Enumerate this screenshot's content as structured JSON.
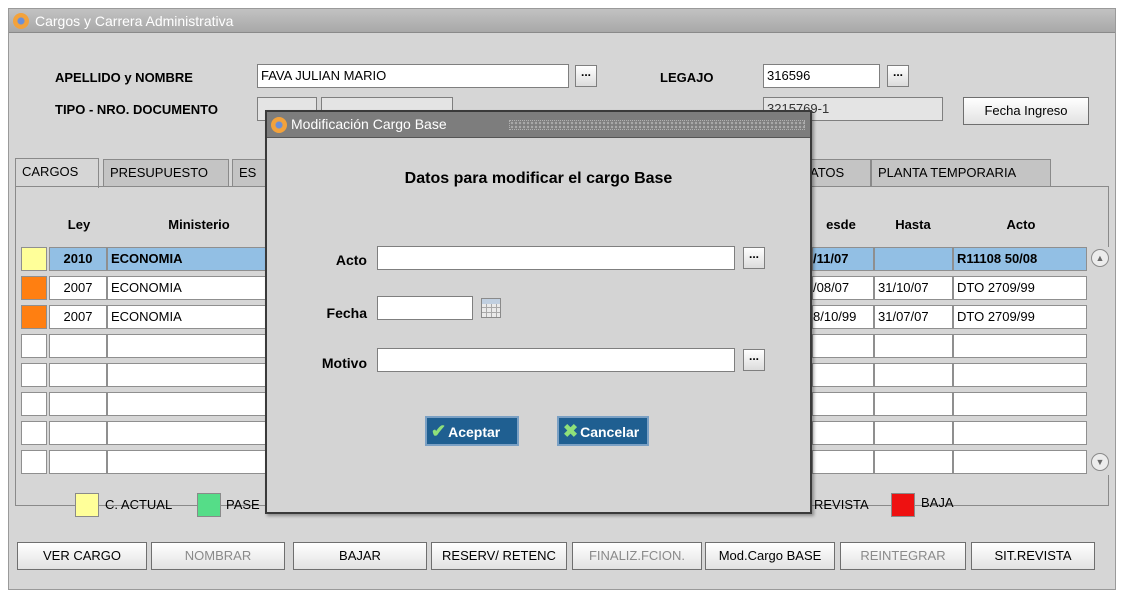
{
  "window": {
    "title": "Cargos y Carrera Administrativa"
  },
  "header": {
    "apellido_label": "APELLIDO y NOMBRE",
    "apellido_value": "FAVA JULIAN MARIO",
    "legajo_label": "LEGAJO",
    "legajo_value": "316596",
    "tipo_label": "TIPO - NRO. DOCUMENTO",
    "cuit_value": "3215769-1",
    "fecha_ingreso_button": "Fecha Ingreso",
    "lookup_glyph": "..."
  },
  "tabs": [
    {
      "label": "CARGOS",
      "active": true
    },
    {
      "label": "PRESUPUESTO"
    },
    {
      "label": "ES"
    },
    {
      "label": "ATOS"
    },
    {
      "label": "PLANTA TEMPORARIA"
    }
  ],
  "table": {
    "headers": {
      "ley": "Ley",
      "ministerio": "Ministerio",
      "desde": "esde",
      "hasta": "Hasta",
      "acto": "Acto"
    },
    "rows": [
      {
        "ley": "2010",
        "ministerio": "ECONOMIA",
        "desde": "/11/07",
        "hasta": "",
        "acto": "R11108 50/08",
        "status": "C. ACTUAL",
        "selected": true
      },
      {
        "ley": "2007",
        "ministerio": "ECONOMIA",
        "desde": "/08/07",
        "hasta": "31/10/07",
        "acto": "DTO 2709/99",
        "status": "orange"
      },
      {
        "ley": "2007",
        "ministerio": "ECONOMIA",
        "desde": "8/10/99",
        "hasta": "31/07/07",
        "acto": "DTO 2709/99",
        "status": "orange"
      }
    ],
    "empty_rows": 5
  },
  "legend": {
    "actual": {
      "label": "C. ACTUAL",
      "color": "#ffff99"
    },
    "pase": {
      "label": "PASE",
      "color": "#55dd88"
    },
    "revista": {
      "label": "REVISTA"
    },
    "baja": {
      "label": "BAJA",
      "color": "#ee1111"
    }
  },
  "status_colors": {
    "orange": "#ff7f11",
    "selected_row": "#92bfe4"
  },
  "buttons": {
    "ver_cargo": "VER CARGO",
    "nombrar": "NOMBRAR",
    "bajar": "BAJAR",
    "reserv": "RESERV/ RETENC",
    "finaliz": "FINALIZ.FCION.",
    "mod_cargo": "Mod.Cargo BASE",
    "reintegrar": "REINTEGRAR",
    "sit_revista": "SIT.REVISTA"
  },
  "dialog": {
    "title": "Modificación Cargo Base",
    "heading": "Datos para modificar el cargo Base",
    "acto_label": "Acto",
    "acto_value": "",
    "fecha_label": "Fecha",
    "fecha_value": "",
    "motivo_label": "Motivo",
    "motivo_value": "",
    "ok_label": "Aceptar",
    "cancel_label": "Cancelar",
    "ok_icon": "check-icon",
    "cancel_icon": "x-icon"
  }
}
